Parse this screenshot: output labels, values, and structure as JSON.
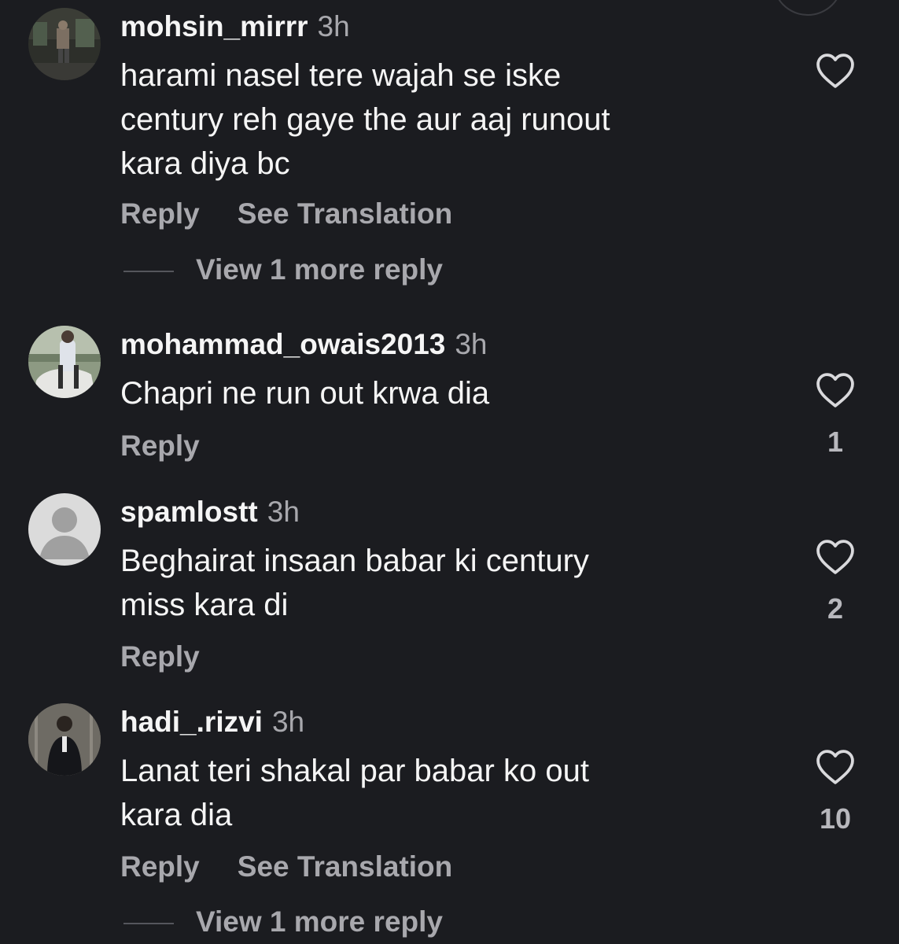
{
  "comments": [
    {
      "username": "mohsin_mirrr",
      "time": "3h",
      "lines": [
        "harami nasel tere wajah se iske",
        "century reh gaye the aur aaj runout",
        "kara diya bc"
      ],
      "reply_label": "Reply",
      "translate_label": "See Translation",
      "view_more_label": "View 1 more reply",
      "like_count": ""
    },
    {
      "username": "mohammad_owais2013",
      "time": "3h",
      "lines": [
        "Chapri ne run out krwa dia"
      ],
      "reply_label": "Reply",
      "like_count": "1"
    },
    {
      "username": "spamlostt",
      "time": "3h",
      "lines": [
        "Beghairat insaan babar ki century",
        "miss kara di"
      ],
      "reply_label": "Reply",
      "like_count": "2"
    },
    {
      "username": "hadi_.rizvi",
      "time": "3h",
      "lines": [
        "Lanat teri shakal par babar ko out",
        "kara dia"
      ],
      "reply_label": "Reply",
      "translate_label": "See Translation",
      "view_more_label": "View 1 more reply",
      "like_count": "10"
    }
  ],
  "icons": {
    "like": "heart-outline-icon",
    "default_avatar": "person-placeholder-icon"
  },
  "colors": {
    "background": "#1b1c20",
    "primary_text": "#f5f5f5",
    "secondary_text": "#a8a8ad"
  }
}
